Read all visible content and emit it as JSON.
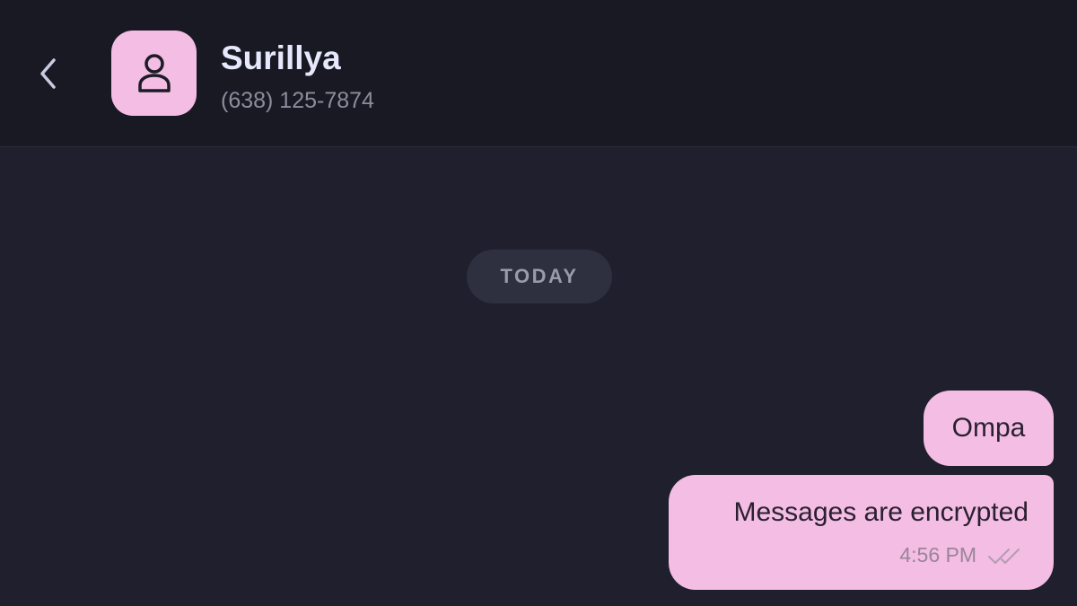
{
  "header": {
    "back_icon": "chevron-left-icon",
    "avatar_icon": "person-icon",
    "contact_name": "Surillya",
    "contact_phone": "(638) 125-7874"
  },
  "chat": {
    "date_divider": "TODAY",
    "messages": [
      {
        "text": "Ompa",
        "direction": "outgoing"
      },
      {
        "text": "Messages are encrypted",
        "direction": "outgoing",
        "time": "4:56 PM",
        "status_icon": "double-check-icon"
      }
    ]
  },
  "colors": {
    "background": "#1f1f2d",
    "header_background": "#191924",
    "accent_pink": "#f3bde4",
    "name_text": "#e6e8fb",
    "muted_text": "#8c8c9c"
  }
}
